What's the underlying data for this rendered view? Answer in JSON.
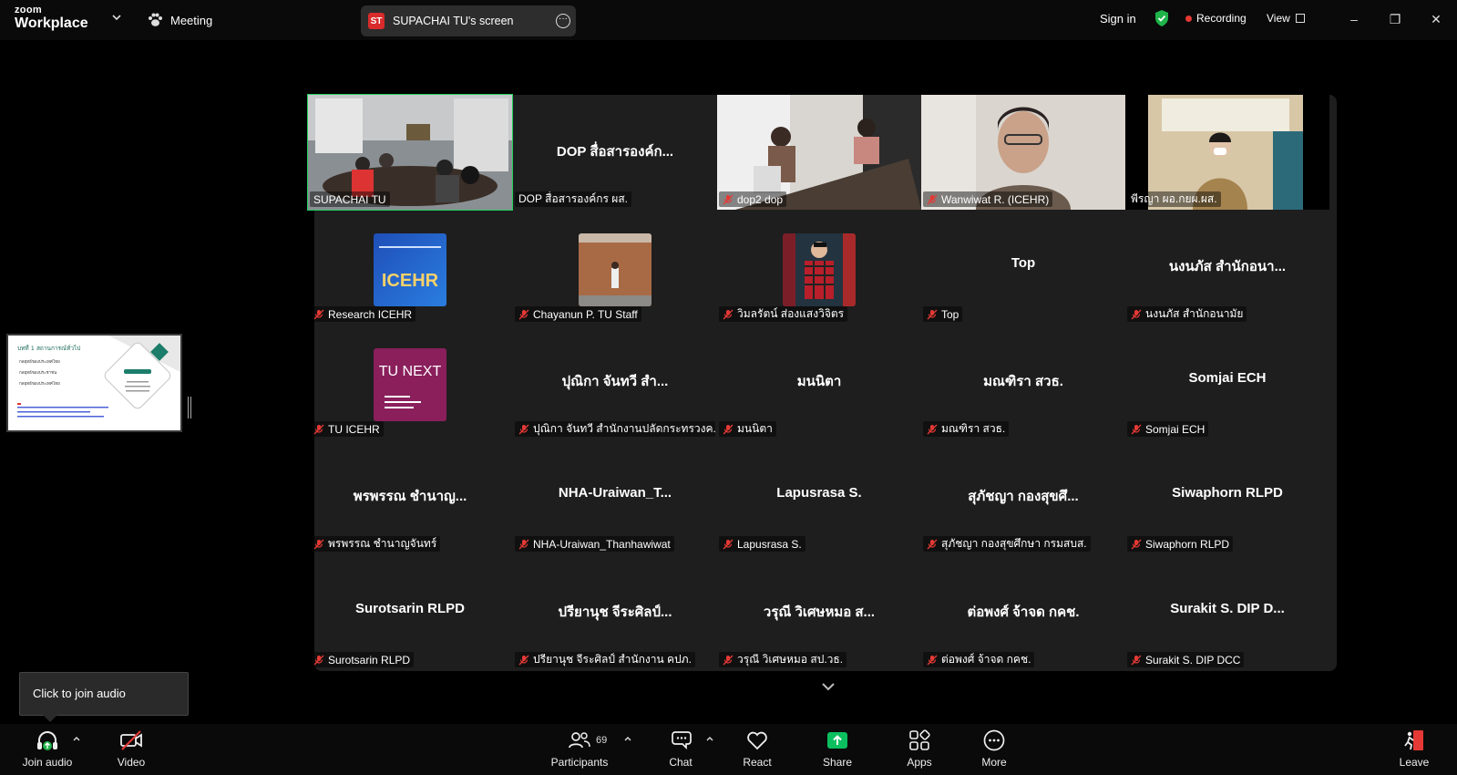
{
  "topbar": {
    "logo_line1": "zoom",
    "logo_line2": "Workplace",
    "meeting_label": "Meeting",
    "share_initials": "ST",
    "share_title": "SUPACHAI TU's screen",
    "signin_label": "Sign in",
    "recording_label": "Recording",
    "view_label": "View"
  },
  "tiles": [
    {
      "row": 0,
      "col": 0,
      "kind": "video",
      "label": "SUPACHAI TU",
      "active": true,
      "muted": false
    },
    {
      "row": 0,
      "col": 1,
      "kind": "name",
      "center": "DOP สื่อสารองค์ก...",
      "label": "DOP สื่อสารองค์กร ผส.",
      "muted": false
    },
    {
      "row": 0,
      "col": 2,
      "kind": "video",
      "label": "dop2 dop",
      "muted": true
    },
    {
      "row": 0,
      "col": 3,
      "kind": "video",
      "label": "Wanwiwat R. (ICEHR)",
      "muted": true
    },
    {
      "row": 0,
      "col": 4,
      "kind": "video",
      "label": "พีรญา ผอ.กยผ.ผส.",
      "muted": false
    },
    {
      "row": 1,
      "col": 0,
      "kind": "avatar",
      "avatar": "icehr",
      "avatar_text": "ICEHR",
      "label": "Research ICEHR",
      "muted": true
    },
    {
      "row": 1,
      "col": 1,
      "kind": "avatar",
      "avatar": "photo1",
      "label": "Chayanun P. TU Staff",
      "muted": true
    },
    {
      "row": 1,
      "col": 2,
      "kind": "avatar",
      "avatar": "photo2",
      "label": "วิมลรัตน์ ส่องแสงวิจิตร",
      "muted": true
    },
    {
      "row": 1,
      "col": 3,
      "kind": "name",
      "center": "Top",
      "label": "Top",
      "muted": true
    },
    {
      "row": 1,
      "col": 4,
      "kind": "name",
      "center": "นงนภัส สำนักอนา...",
      "label": "นงนภัส สำนักอนามัย",
      "muted": true
    },
    {
      "row": 2,
      "col": 0,
      "kind": "avatar",
      "avatar": "tunext",
      "avatar_text": "TU NEXT",
      "label": "TU ICEHR",
      "muted": true
    },
    {
      "row": 2,
      "col": 1,
      "kind": "name",
      "center": "ปุณิกา จันทวี สำ...",
      "label": "ปุณิกา จันทวี สำนักงานปลัดกระทรวงค...",
      "muted": true
    },
    {
      "row": 2,
      "col": 2,
      "kind": "name",
      "center": "มนนิตา",
      "label": "มนนิตา",
      "muted": true
    },
    {
      "row": 2,
      "col": 3,
      "kind": "name",
      "center": "มณฑิรา สวธ.",
      "label": "มณฑิรา สวธ.",
      "muted": true
    },
    {
      "row": 2,
      "col": 4,
      "kind": "name",
      "center": "Somjai ECH",
      "label": "Somjai ECH",
      "muted": true
    },
    {
      "row": 3,
      "col": 0,
      "kind": "name",
      "center": "พรพรรณ ชำนาญ...",
      "label": "พรพรรณ ชำนาญจันทร์",
      "muted": true
    },
    {
      "row": 3,
      "col": 1,
      "kind": "name",
      "center": "NHA-Uraiwan_T...",
      "label": "NHA-Uraiwan_Thanhawiwat",
      "muted": true
    },
    {
      "row": 3,
      "col": 2,
      "kind": "name",
      "center": "Lapusrasa S.",
      "label": "Lapusrasa S.",
      "muted": true
    },
    {
      "row": 3,
      "col": 3,
      "kind": "name",
      "center": "สุภัชญา กองสุขศึ...",
      "label": "สุภัชญา กองสุขศึกษา กรมสบส.",
      "muted": true
    },
    {
      "row": 3,
      "col": 4,
      "kind": "name",
      "center": "Siwaphorn RLPD",
      "label": "Siwaphorn RLPD",
      "muted": true
    },
    {
      "row": 4,
      "col": 0,
      "kind": "name",
      "center": "Surotsarin RLPD",
      "label": "Surotsarin RLPD",
      "muted": true
    },
    {
      "row": 4,
      "col": 1,
      "kind": "name",
      "center": "ปรียานุช จีระศิลป์...",
      "label": "ปรียานุช จีระศิลป์ สำนักงาน คปภ.",
      "muted": true
    },
    {
      "row": 4,
      "col": 2,
      "kind": "name",
      "center": "วรุณี วิเศษหมอ ส...",
      "label": "วรุณี วิเศษหมอ สป.วธ.",
      "muted": true
    },
    {
      "row": 4,
      "col": 3,
      "kind": "name",
      "center": "ต่อพงศ์ จ้าจด กคช.",
      "label": "ต่อพงศ์ จ้าจด กคช.",
      "muted": true
    },
    {
      "row": 4,
      "col": 4,
      "kind": "name",
      "center": "Surakit S. DIP D...",
      "label": "Surakit S. DIP DCC",
      "muted": true
    }
  ],
  "slide": {
    "heading": "บทที่ 1 สถานการณ์ทั่วไป",
    "bullets": [
      "กลยุทธ์ของประเทศไทย",
      "กลยุทธ์ของประชาชน",
      "กลยุทธ์ของประเทศไทย"
    ]
  },
  "tooltip_text": "Click to join audio",
  "participants_count": "69",
  "toolbar": {
    "join_audio": "Join audio",
    "video": "Video",
    "participants": "Participants",
    "chat": "Chat",
    "react": "React",
    "share": "Share",
    "apps": "Apps",
    "more": "More",
    "leave": "Leave"
  },
  "colors": {
    "accent_green": "#23d160",
    "share_green": "#0bbf5f",
    "muted_red": "#e53935",
    "tile_bg": "#1e1e1e"
  }
}
